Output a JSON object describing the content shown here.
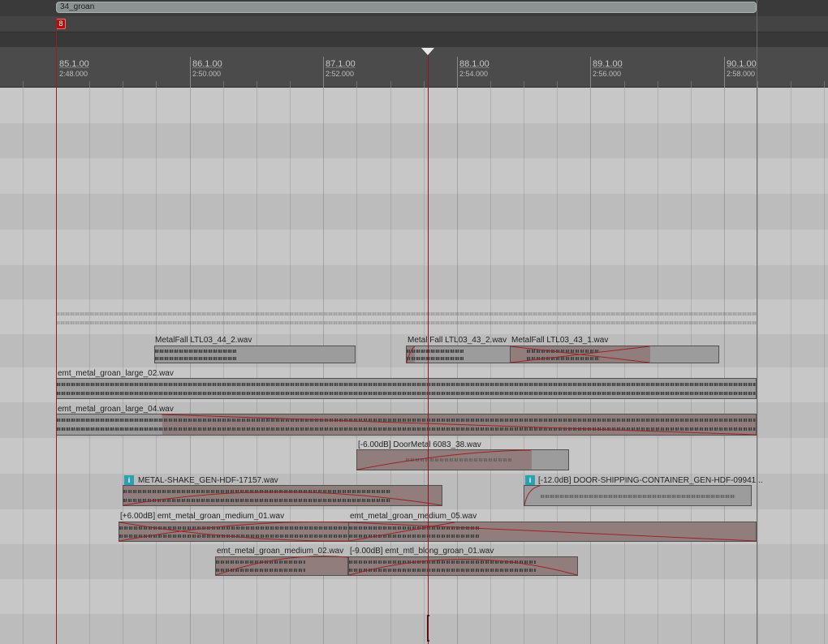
{
  "region": {
    "label": "34_groan"
  },
  "marker": {
    "label": "8"
  },
  "ruler": [
    {
      "bar": "85.1.00",
      "time": "2:48.000"
    },
    {
      "bar": "86.1.00",
      "time": "2:50.000"
    },
    {
      "bar": "87.1.00",
      "time": "2:52.000"
    },
    {
      "bar": "88.1.00",
      "time": "2:54.000"
    },
    {
      "bar": "89.1.00",
      "time": "2:56.000"
    },
    {
      "bar": "90.1.00",
      "time": "2:58.000"
    }
  ],
  "items": {
    "metalfall_44_2": "MetalFall LTL03_44_2.wav",
    "metalfall_43_2": "Metal Fall LTL03_43_2.wav",
    "metalfall_43_1": "MetalFall LTL03_43_1.wav",
    "groan_large_02": "emt_metal_groan_large_02.wav",
    "groan_large_04": "emt_metal_groan_large_04.wav",
    "doormetal": "[-6.00dB] DoorMetal 6083_38.wav",
    "metal_shake": "METAL-SHAKE_GEN-HDF-17157.wav",
    "door_shipping": "[-12.0dB] DOOR-SHIPPING-CONTAINER_GEN-HDF-09941...",
    "groan_medium_01": "[+6.00dB] emt_metal_groan_medium_01.wav",
    "groan_medium_05": "emt_metal_groan_medium_05.wav",
    "groan_medium_02": "emt_metal_groan_medium_02.wav",
    "blong_groan_01": "[-9.00dB] emt_mtl_blong_groan_01.wav"
  },
  "icons": {
    "info": "info-icon",
    "playhead": "playhead-triangle-icon"
  },
  "colors": {
    "track_bg": "#bdbdbd",
    "playhead": "#8a1a1a",
    "marker": "#b01010",
    "info_badge": "#2aa0b4"
  }
}
